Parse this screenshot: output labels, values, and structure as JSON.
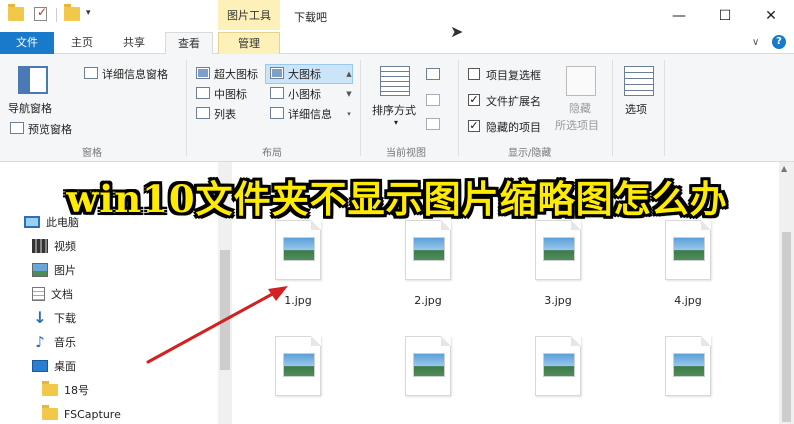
{
  "window": {
    "title": "下载吧",
    "context_tab_group": "图片工具",
    "controls": {
      "minimize": "—",
      "maximize": "☐",
      "close": "✕"
    }
  },
  "tabs": [
    {
      "label": "文件"
    },
    {
      "label": "主页"
    },
    {
      "label": "共享"
    },
    {
      "label": "查看"
    },
    {
      "label": "管理"
    }
  ],
  "ribbon": {
    "pane": {
      "group_label": "窗格",
      "nav_pane": "导航窗格",
      "preview_pane": "预览窗格",
      "details_pane": "详细信息窗格"
    },
    "layout": {
      "group_label": "布局",
      "options": [
        "超大图标",
        "大图标",
        "中图标",
        "小图标",
        "列表",
        "详细信息"
      ],
      "selected": "大图标"
    },
    "current_view": {
      "group_label": "当前视图",
      "sort_by": "排序方式"
    },
    "show_hide": {
      "group_label": "显示/隐藏",
      "item_checkboxes": {
        "label": "项目复选框",
        "checked": false
      },
      "file_extensions": {
        "label": "文件扩展名",
        "checked": true
      },
      "hidden_items": {
        "label": "隐藏的项目",
        "checked": true
      },
      "hide_selected_line1": "隐藏",
      "hide_selected_line2": "所选项目"
    },
    "options": {
      "label": "选项"
    }
  },
  "nav_pane": {
    "items": [
      {
        "label": "此电脑",
        "icon": "computer-icon"
      },
      {
        "label": "视频",
        "icon": "video-folder-icon"
      },
      {
        "label": "图片",
        "icon": "pictures-folder-icon"
      },
      {
        "label": "文档",
        "icon": "documents-folder-icon"
      },
      {
        "label": "下载",
        "icon": "download-arrow-icon"
      },
      {
        "label": "音乐",
        "icon": "music-note-icon"
      },
      {
        "label": "桌面",
        "icon": "desktop-icon"
      },
      {
        "label": "18号",
        "icon": "folder-icon"
      },
      {
        "label": "FSCapture",
        "icon": "folder-icon"
      }
    ]
  },
  "files": [
    {
      "name": "1.jpg"
    },
    {
      "name": "2.jpg"
    },
    {
      "name": "3.jpg"
    },
    {
      "name": "4.jpg"
    },
    {
      "name": ""
    },
    {
      "name": ""
    },
    {
      "name": ""
    },
    {
      "name": ""
    }
  ],
  "overlay": {
    "banner": "win10文件夹不显示图片缩略图怎么办",
    "banner_color": "#ffeb00",
    "arrow_color": "#d32020"
  }
}
